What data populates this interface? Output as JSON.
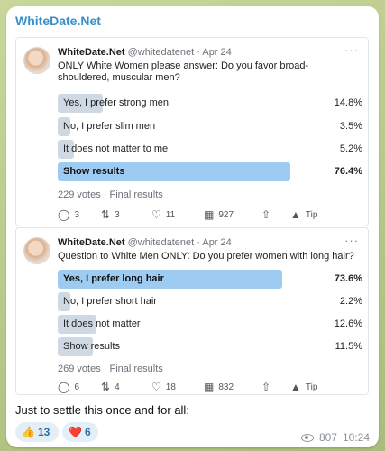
{
  "channel": {
    "name": "WhiteDate.Net"
  },
  "tweets": [
    {
      "author": "WhiteDate.Net",
      "handle": "@whitedatenet",
      "date": "Apr 24",
      "question": "ONLY White Women please answer: Do you favor broad-shouldered, muscular men?",
      "options": [
        {
          "label": "Yes, I prefer strong men",
          "percent": "14.8%",
          "fill": 14.8,
          "winner": false
        },
        {
          "label": "No, I prefer slim men",
          "percent": "3.5%",
          "fill": 3.5,
          "winner": false
        },
        {
          "label": "It does not matter to me",
          "percent": "5.2%",
          "fill": 5.2,
          "winner": false
        },
        {
          "label": "Show results",
          "percent": "76.4%",
          "fill": 76.4,
          "winner": true
        }
      ],
      "votes": "229 votes · Final results",
      "actions": {
        "replies": "3",
        "retweets": "3",
        "likes": "11",
        "views": "927",
        "tip": "Tip"
      }
    },
    {
      "author": "WhiteDate.Net",
      "handle": "@whitedatenet",
      "date": "Apr 24",
      "question": "Question to White Men ONLY: Do you prefer women with long hair?",
      "options": [
        {
          "label": "Yes, I prefer long hair",
          "percent": "73.6%",
          "fill": 73.6,
          "winner": true
        },
        {
          "label": "No, I prefer short hair",
          "percent": "2.2%",
          "fill": 2.2,
          "winner": false
        },
        {
          "label": "It does not matter",
          "percent": "12.6%",
          "fill": 12.6,
          "winner": false
        },
        {
          "label": "Show results",
          "percent": "11.5%",
          "fill": 11.5,
          "winner": false
        }
      ],
      "votes": "269 votes · Final results",
      "actions": {
        "replies": "6",
        "retweets": "4",
        "likes": "18",
        "views": "832",
        "tip": "Tip"
      }
    }
  ],
  "caption": "Just to settle this once and for all:",
  "reactions": [
    {
      "emoji": "👍",
      "count": "13"
    },
    {
      "emoji": "❤️",
      "count": "6"
    }
  ],
  "footer": {
    "views": "807",
    "time": "10:24"
  },
  "icons": {
    "reply": "reply-icon",
    "retweet": "retweet-icon",
    "like": "heart-icon",
    "views": "bar-chart-icon",
    "share": "share-icon",
    "tip": "tip-icon",
    "eye": "eye-icon"
  },
  "colors": {
    "accent": "#3a8fc9",
    "winner_fill": "#9ecbf2",
    "option_fill": "#cfd9e3"
  }
}
